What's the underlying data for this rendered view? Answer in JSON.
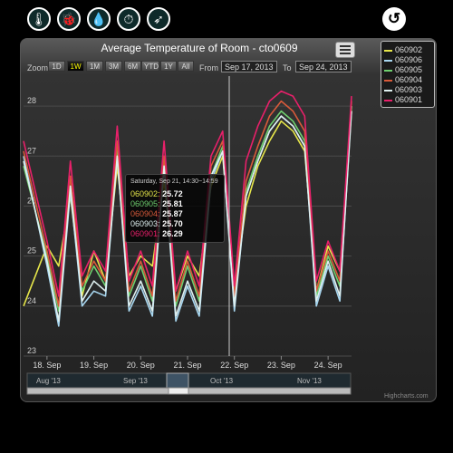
{
  "toolbar": {
    "icons": [
      {
        "name": "thermometer-icon",
        "glyph": "🌡"
      },
      {
        "name": "bug-icon",
        "glyph": "🐞"
      },
      {
        "name": "drops-icon",
        "glyph": "💧"
      },
      {
        "name": "gauge-icon",
        "glyph": "⏱"
      },
      {
        "name": "leaf-icon",
        "glyph": "➶"
      }
    ],
    "back_glyph": "↺"
  },
  "chart_data": {
    "type": "line",
    "title": "Average Temperature of Room - cto0609",
    "x_ticks": [
      "18. Sep",
      "19. Sep",
      "20. Sep",
      "21. Sep",
      "22. Sep",
      "23. Sep",
      "24. Sep"
    ],
    "y_ticks": [
      23,
      24,
      25,
      26,
      27,
      28
    ],
    "ylim": [
      23,
      28.6
    ],
    "xlim": [
      "Sep 17, 2013 12:00",
      "Sep 24, 2013 12:00"
    ],
    "grid": true,
    "legend_placement": "top-right",
    "series": [
      {
        "name": "060902",
        "color": "#e6e64a",
        "x": [
          17.5,
          18.0,
          18.25,
          18.5,
          18.75,
          19.0,
          19.25,
          19.5,
          19.75,
          20.0,
          20.25,
          20.5,
          20.75,
          21.0,
          21.25,
          21.5,
          21.75,
          22.0,
          22.25,
          22.5,
          22.75,
          23.0,
          23.25,
          23.5,
          23.75,
          24.0,
          24.25,
          24.5
        ],
        "values": [
          24.0,
          25.2,
          24.8,
          26.2,
          24.2,
          25.1,
          24.5,
          26.8,
          24.6,
          25.0,
          24.8,
          26.5,
          24.3,
          25.0,
          24.6,
          26.4,
          27.0,
          24.3,
          26.0,
          26.8,
          27.3,
          27.7,
          27.5,
          27.1,
          24.3,
          25.2,
          24.7,
          27.9
        ]
      },
      {
        "name": "060906",
        "color": "#a8d7f0",
        "x": [
          17.5,
          18.0,
          18.25,
          18.5,
          18.75,
          19.0,
          19.25,
          19.5,
          19.75,
          20.0,
          20.25,
          20.5,
          20.75,
          21.0,
          21.25,
          21.5,
          21.75,
          22.0,
          22.25,
          22.5,
          22.75,
          23.0,
          23.25,
          23.5,
          23.75,
          24.0,
          24.25,
          24.5
        ],
        "values": [
          27.0,
          24.8,
          23.6,
          26.3,
          24.0,
          24.3,
          24.2,
          27.0,
          23.9,
          24.4,
          23.8,
          26.8,
          23.7,
          24.4,
          23.8,
          26.5,
          27.1,
          23.9,
          26.2,
          26.9,
          27.5,
          27.8,
          27.6,
          27.2,
          24.0,
          24.8,
          24.1,
          28.0
        ]
      },
      {
        "name": "060905",
        "color": "#6fcf6f",
        "x": [
          17.5,
          18.0,
          18.25,
          18.5,
          18.75,
          19.0,
          19.25,
          19.5,
          19.75,
          20.0,
          20.25,
          20.5,
          20.75,
          21.0,
          21.25,
          21.5,
          21.75,
          22.0,
          22.25,
          22.5,
          22.75,
          23.0,
          23.25,
          23.5,
          23.75,
          24.0,
          24.25,
          24.5
        ],
        "values": [
          26.8,
          25.0,
          23.9,
          26.4,
          24.3,
          24.8,
          24.4,
          27.1,
          24.2,
          24.8,
          24.1,
          26.9,
          24.0,
          24.8,
          24.1,
          26.6,
          27.2,
          24.1,
          26.3,
          27.0,
          27.6,
          27.9,
          27.7,
          27.3,
          24.2,
          25.0,
          24.4,
          28.0
        ]
      },
      {
        "name": "060904",
        "color": "#d85a3a",
        "x": [
          17.5,
          18.0,
          18.25,
          18.5,
          18.75,
          19.0,
          19.25,
          19.5,
          19.75,
          20.0,
          20.25,
          20.5,
          20.75,
          21.0,
          21.25,
          21.5,
          21.75,
          22.0,
          22.25,
          22.5,
          22.75,
          23.0,
          23.25,
          23.5,
          23.75,
          24.0,
          24.25,
          24.5
        ],
        "values": [
          27.1,
          25.1,
          24.0,
          26.6,
          24.4,
          24.9,
          24.5,
          27.3,
          24.3,
          24.9,
          24.2,
          27.0,
          24.1,
          24.9,
          24.2,
          26.8,
          27.3,
          24.2,
          26.5,
          27.2,
          27.8,
          28.1,
          27.9,
          27.5,
          24.3,
          25.1,
          24.5,
          28.1
        ]
      },
      {
        "name": "060903",
        "color": "#dff0f0",
        "x": [
          17.5,
          18.0,
          18.25,
          18.5,
          18.75,
          19.0,
          19.25,
          19.5,
          19.75,
          20.0,
          20.25,
          20.5,
          20.75,
          21.0,
          21.25,
          21.5,
          21.75,
          22.0,
          22.25,
          22.5,
          22.75,
          23.0,
          23.25,
          23.5,
          23.75,
          24.0,
          24.25,
          24.5
        ],
        "values": [
          26.9,
          24.9,
          23.7,
          26.4,
          24.1,
          24.5,
          24.3,
          27.0,
          24.0,
          24.5,
          23.9,
          26.8,
          23.8,
          24.5,
          23.9,
          26.6,
          27.1,
          24.0,
          26.2,
          26.9,
          27.5,
          27.8,
          27.6,
          27.2,
          24.1,
          24.9,
          24.2,
          27.9
        ]
      },
      {
        "name": "060901",
        "color": "#e8206a",
        "x": [
          17.5,
          18.0,
          18.25,
          18.5,
          18.75,
          19.0,
          19.25,
          19.5,
          19.75,
          20.0,
          20.25,
          20.5,
          20.75,
          21.0,
          21.25,
          21.5,
          21.75,
          22.0,
          22.25,
          22.5,
          22.75,
          23.0,
          23.25,
          23.5,
          23.75,
          24.0,
          24.25,
          24.5
        ],
        "values": [
          27.3,
          25.3,
          24.2,
          26.9,
          24.6,
          25.1,
          24.7,
          27.6,
          24.5,
          25.1,
          24.4,
          27.3,
          24.3,
          25.1,
          24.4,
          27.0,
          27.5,
          24.4,
          26.9,
          27.6,
          28.1,
          28.3,
          28.2,
          27.8,
          24.5,
          25.3,
          24.7,
          28.2
        ]
      }
    ]
  },
  "zoom": {
    "label": "Zoom",
    "buttons": [
      "1D",
      "1W",
      "1M",
      "3M",
      "6M",
      "YTD",
      "1Y",
      "All"
    ],
    "active": "1W"
  },
  "range": {
    "from_label": "From",
    "from_value": "Sep 17, 2013",
    "to_label": "To",
    "to_value": "Sep 24, 2013"
  },
  "navigator": {
    "labels": [
      "Aug '13",
      "Sep '13",
      "Oct '13",
      "Nov '13"
    ]
  },
  "tooltip": {
    "header": "Saturday, Sep 21, 14:30~14:59",
    "rows": [
      {
        "series": "060902",
        "value": "25.72",
        "color": "#e6e64a"
      },
      {
        "series": "060905",
        "value": "25.81",
        "color": "#6fcf6f"
      },
      {
        "series": "060904",
        "value": "25.87",
        "color": "#d85a3a"
      },
      {
        "series": "060903",
        "value": "25.70",
        "color": "#dff0f0"
      },
      {
        "series": "060901",
        "value": "26.29",
        "color": "#e8206a"
      }
    ]
  },
  "credits": "Highcharts.com"
}
